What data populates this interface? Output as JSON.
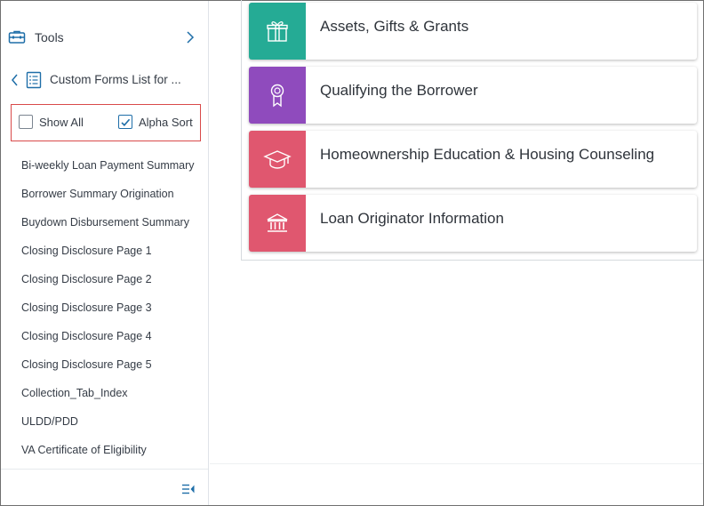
{
  "sidebar": {
    "tools": {
      "label": "Tools",
      "icon": "toolbox-icon"
    },
    "forms_list": {
      "label": "Custom Forms List for ...",
      "icon": "document-list-icon"
    },
    "filters": {
      "show_all": {
        "label": "Show All",
        "checked": false
      },
      "alpha_sort": {
        "label": "Alpha Sort",
        "checked": true
      }
    },
    "items": [
      "Bi-weekly Loan Payment Summary",
      "Borrower Summary Origination",
      "Buydown Disbursement Summary",
      "Closing Disclosure Page 1",
      "Closing Disclosure Page 2",
      "Closing Disclosure Page 3",
      "Closing Disclosure Page 4",
      "Closing Disclosure Page 5",
      "Collection_Tab_Index",
      "ULDD/PDD",
      "VA Certificate of Eligibility"
    ]
  },
  "cards": [
    {
      "title": "Assets, Gifts & Grants",
      "color": "#25ab95",
      "icon": "gift-icon"
    },
    {
      "title": "Qualifying the Borrower",
      "color": "#8f4bbd",
      "icon": "ribbon-badge-icon"
    },
    {
      "title": "Homeownership Education & Housing Counseling",
      "color": "#e0576f",
      "icon": "graduation-cap-icon"
    },
    {
      "title": "Loan Originator Information",
      "color": "#e0576f",
      "icon": "bank-building-icon"
    }
  ],
  "colors": {
    "accent": "#1e6ea8",
    "highlight_border": "#d94a4a"
  }
}
